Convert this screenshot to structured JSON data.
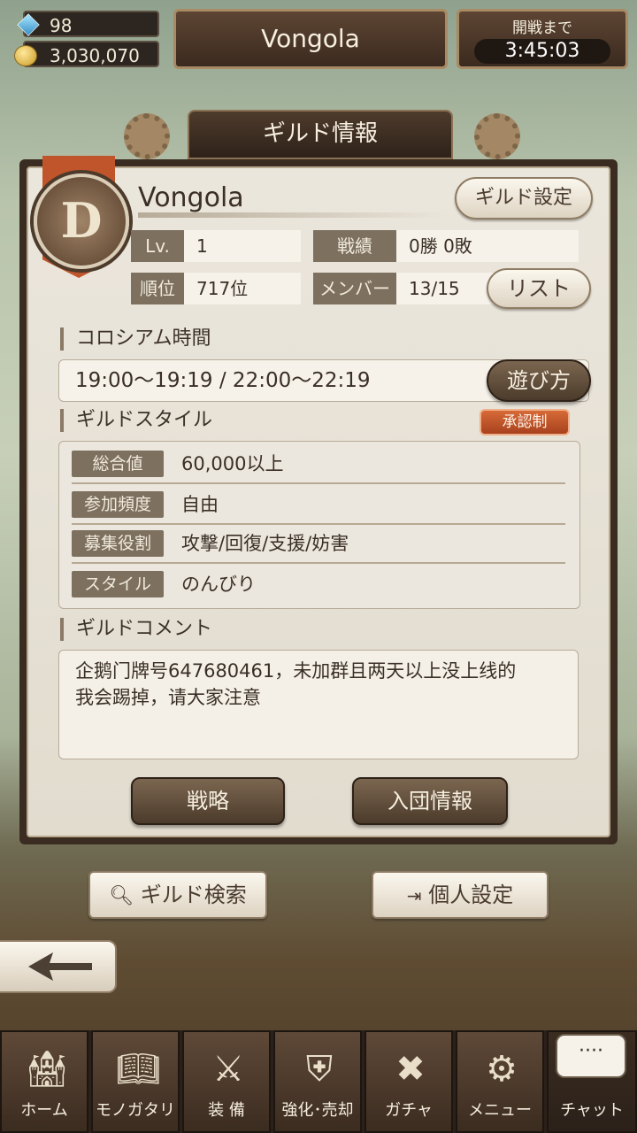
{
  "topbar": {
    "gems": "98",
    "gold": "3,030,070",
    "guild_name": "Vongola",
    "timer_label": "開戦まで",
    "timer_value": "3:45:03"
  },
  "panel": {
    "title": "ギルド情報",
    "emblem_letter": "D",
    "guild_name": "Vongola",
    "settings_button": "ギルド設定",
    "stats": {
      "level_label": "Lv.",
      "level_value": "1",
      "record_label": "戦績",
      "record_value": "0勝 0敗",
      "rank_label": "順位",
      "rank_value": "717位",
      "members_label": "メンバー",
      "members_value": "13/15",
      "list_button": "リスト"
    },
    "colosseum": {
      "title": "コロシアム時間",
      "time": "19:00〜19:19  /  22:00〜22:19",
      "howto_button": "遊び方"
    },
    "style": {
      "title": "ギルドスタイル",
      "badge": "承認制",
      "rows": [
        {
          "label": "総合値",
          "value": "60,000以上"
        },
        {
          "label": "参加頻度",
          "value": "自由"
        },
        {
          "label": "募集役割",
          "value": "攻撃/回復/支援/妨害"
        },
        {
          "label": "スタイル",
          "value": "のんびり"
        }
      ]
    },
    "comment": {
      "title": "ギルドコメント",
      "line1": "企鹅门牌号647680461，未加群且两天以上没上线的",
      "line2": "我会踢掉，请大家注意"
    },
    "buttons": {
      "strategy": "戦略",
      "join_info": "入団情報"
    }
  },
  "actions": {
    "guild_search": "ギルド検索",
    "personal_settings": "個人設定"
  },
  "nav": {
    "items": [
      {
        "label": "ホーム",
        "icon": "home-icon"
      },
      {
        "label": "モノガタリ",
        "icon": "book-icon"
      },
      {
        "label": "装 備",
        "icon": "equipment-icon"
      },
      {
        "label": "強化･売却",
        "icon": "upgrade-icon"
      },
      {
        "label": "ガチャ",
        "icon": "gacha-icon"
      },
      {
        "label": "メニュー",
        "icon": "gear-icon"
      }
    ],
    "chat_label": "チャット",
    "chat_bubble": "····"
  }
}
